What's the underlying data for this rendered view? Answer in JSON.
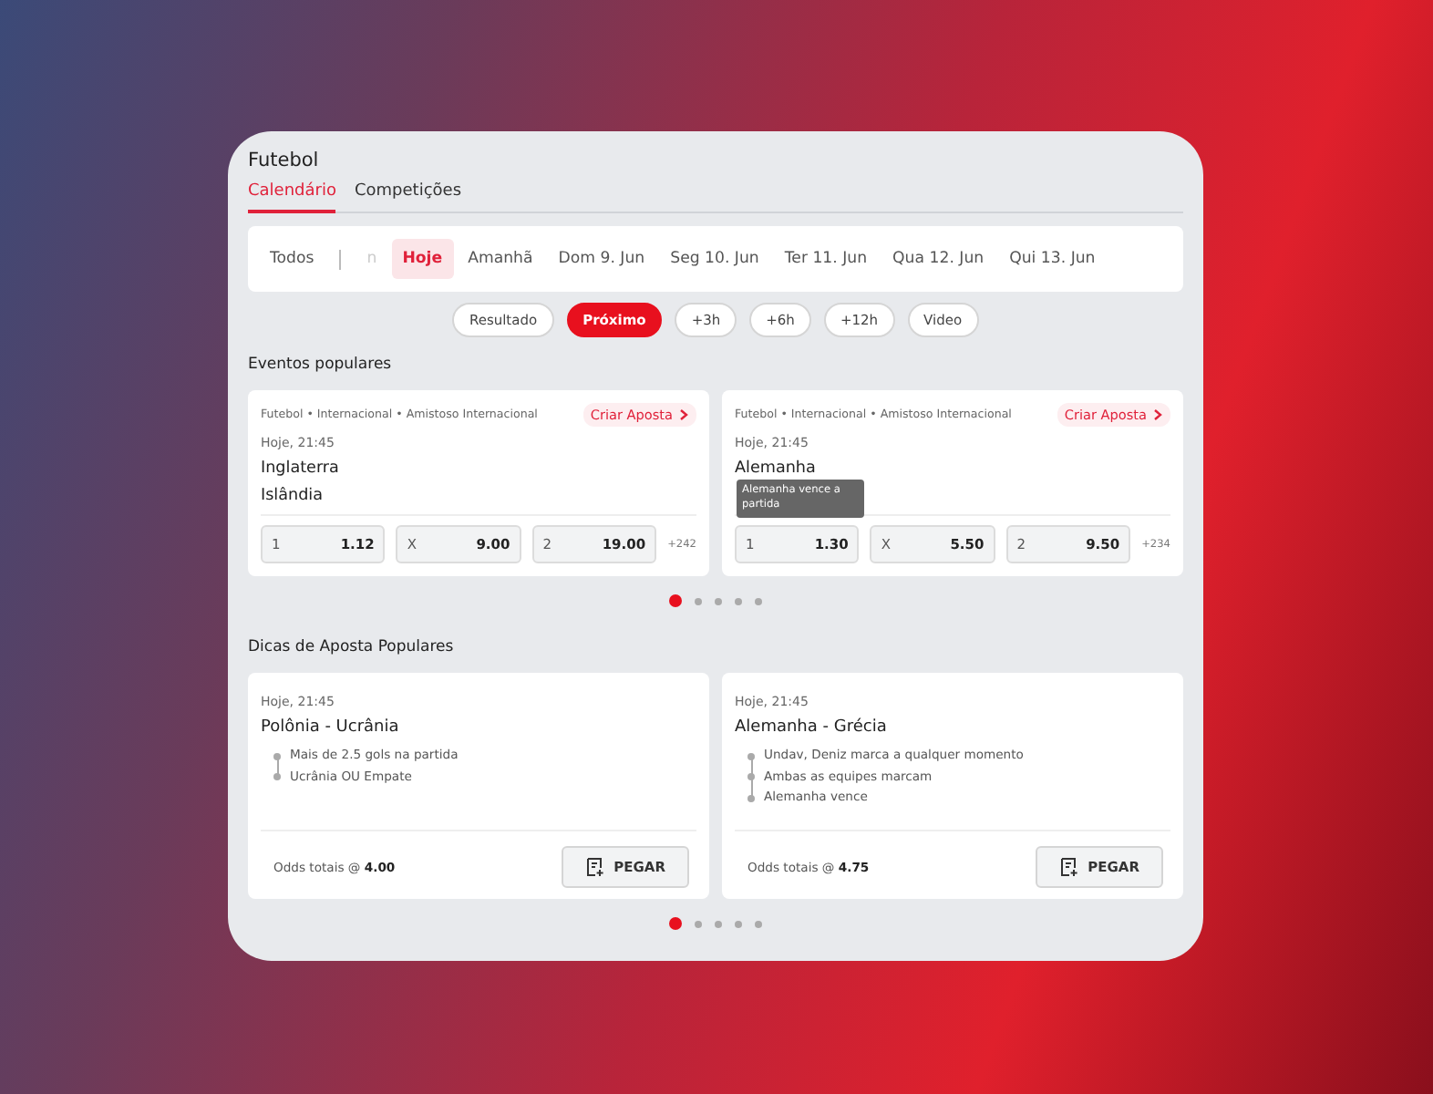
{
  "header": {
    "title": "Futebol"
  },
  "tabs": [
    {
      "label": "Calendário",
      "selected": true
    },
    {
      "label": "Competições",
      "selected": false
    }
  ],
  "date_bar": {
    "all_label": "Todos",
    "items": [
      {
        "label": "n",
        "faded": true,
        "selected": false
      },
      {
        "label": "Hoje",
        "faded": false,
        "selected": true
      },
      {
        "label": "Amanhã",
        "faded": false,
        "selected": false
      },
      {
        "label": "Dom 9. Jun",
        "faded": false,
        "selected": false
      },
      {
        "label": "Seg 10. Jun",
        "faded": false,
        "selected": false
      },
      {
        "label": "Ter 11. Jun",
        "faded": false,
        "selected": false
      },
      {
        "label": "Qua 12. Jun",
        "faded": false,
        "selected": false
      },
      {
        "label": "Qui 13. Jun",
        "faded": false,
        "selected": false
      }
    ]
  },
  "filters": [
    {
      "label": "Resultado",
      "selected": false
    },
    {
      "label": "Próximo",
      "selected": true
    },
    {
      "label": "+3h",
      "selected": false
    },
    {
      "label": "+6h",
      "selected": false
    },
    {
      "label": "+12h",
      "selected": false
    },
    {
      "label": "Video",
      "selected": false
    }
  ],
  "popular_events": {
    "title": "Eventos populares",
    "events": [
      {
        "breadcrumb": "Futebol • Internacional • Amistoso Internacional",
        "create_bet": "Criar Aposta",
        "time": "Hoje, 21:45",
        "teams": [
          "Inglaterra",
          "Islândia"
        ],
        "odds": [
          {
            "label": "1",
            "value": "1.12"
          },
          {
            "label": "X",
            "value": "9.00"
          },
          {
            "label": "2",
            "value": "19.00"
          }
        ],
        "more": "+242"
      },
      {
        "breadcrumb": "Futebol • Internacional • Amistoso Internacional",
        "create_bet": "Criar Aposta",
        "time": "Hoje, 21:45",
        "teams": [
          "Alemanha"
        ],
        "tooltip": "Alemanha vence a partida",
        "odds": [
          {
            "label": "1",
            "value": "1.30"
          },
          {
            "label": "X",
            "value": "5.50"
          },
          {
            "label": "2",
            "value": "9.50"
          }
        ],
        "more": "+234"
      }
    ],
    "dots": [
      {
        "selected": true
      },
      {
        "selected": false
      },
      {
        "selected": false
      },
      {
        "selected": false
      },
      {
        "selected": false
      }
    ]
  },
  "popular_tips": {
    "title": "Dicas de Aposta Populares",
    "tips": [
      {
        "time": "Hoje, 21:45",
        "match": "Polônia - Ucrânia",
        "selections": [
          "Mais de 2.5 gols na partida",
          "Ucrânia OU Empate"
        ],
        "total": "Odds totais @ **4.00**",
        "button": "PEGAR"
      },
      {
        "time": "Hoje, 21:45",
        "match": "Alemanha - Grécia",
        "selections": [
          "Undav, Deniz marca a qualquer momento",
          "Ambas as equipes marcam",
          "Alemanha vence"
        ],
        "total": "Odds totais @ **4.75**",
        "button": "PEGAR"
      }
    ],
    "dots": [
      {
        "selected": true
      },
      {
        "selected": false
      },
      {
        "selected": false
      },
      {
        "selected": false
      },
      {
        "selected": false
      }
    ]
  }
}
